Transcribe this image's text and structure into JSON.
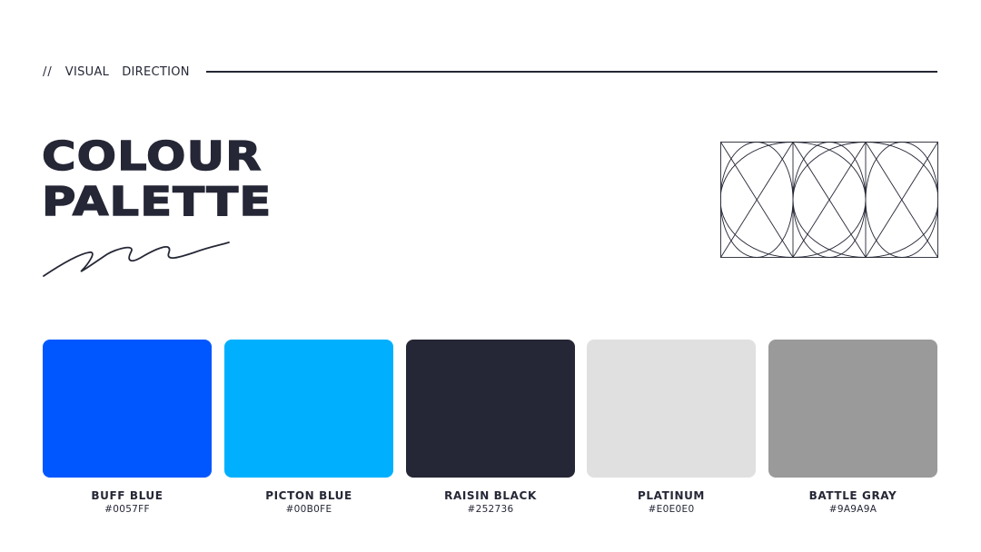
{
  "header": {
    "prefix": "//",
    "word1": "VISUAL",
    "word2": "DIRECTION"
  },
  "title": {
    "line1": "COLOUR",
    "line2": "PALETTE"
  },
  "palette": [
    {
      "name": "BUFF BLUE",
      "hex": "#0057FF",
      "color": "#0057FF"
    },
    {
      "name": "PICTON BLUE",
      "hex": "#00B0FE",
      "color": "#00B0FE"
    },
    {
      "name": "RAISIN BLACK",
      "hex": "#252736",
      "color": "#252736"
    },
    {
      "name": "PLATINUM",
      "hex": "#E0E0E0",
      "color": "#E0E0E0"
    },
    {
      "name": "BATTLE GRAY",
      "hex": "#9A9A9A",
      "color": "#9A9A9A"
    }
  ],
  "decor": {
    "squiggle_icon": "hand-drawn-squiggle-icon",
    "grid_icon": "geometric-grid-circles-icon",
    "ink_color": "#252736"
  }
}
